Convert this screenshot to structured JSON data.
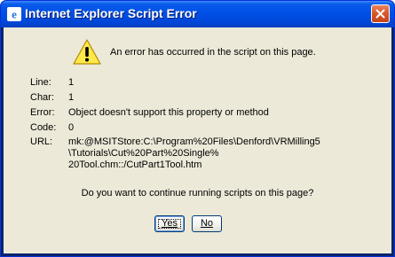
{
  "window": {
    "title": "Internet Explorer Script Error",
    "title_icon": "ie-icon",
    "close_icon": "close-icon"
  },
  "dialog": {
    "icon": "warning-icon",
    "message": "An error has occurred in the script on this page.",
    "details": [
      {
        "label": "Line:",
        "value": "1"
      },
      {
        "label": "Char:",
        "value": "1"
      },
      {
        "label": "Error:",
        "value": "Object doesn't support this property or method"
      },
      {
        "label": "Code:",
        "value": "0"
      }
    ],
    "url_label": "URL:",
    "url_lines": [
      "mk:@MSITStore:C:\\Program%20Files\\Denford\\VRMilling5",
      "\\Tutorials\\Cut%20Part%20Single%",
      "20Tool.chm::/CutPart1Tool.htm"
    ],
    "question": "Do you want to continue running scripts on this page?",
    "yes_button": "Yes",
    "no_button": "No"
  },
  "colors": {
    "titlebar": "#0050e6",
    "body": "#ece9d8",
    "close": "#d95a2a"
  }
}
